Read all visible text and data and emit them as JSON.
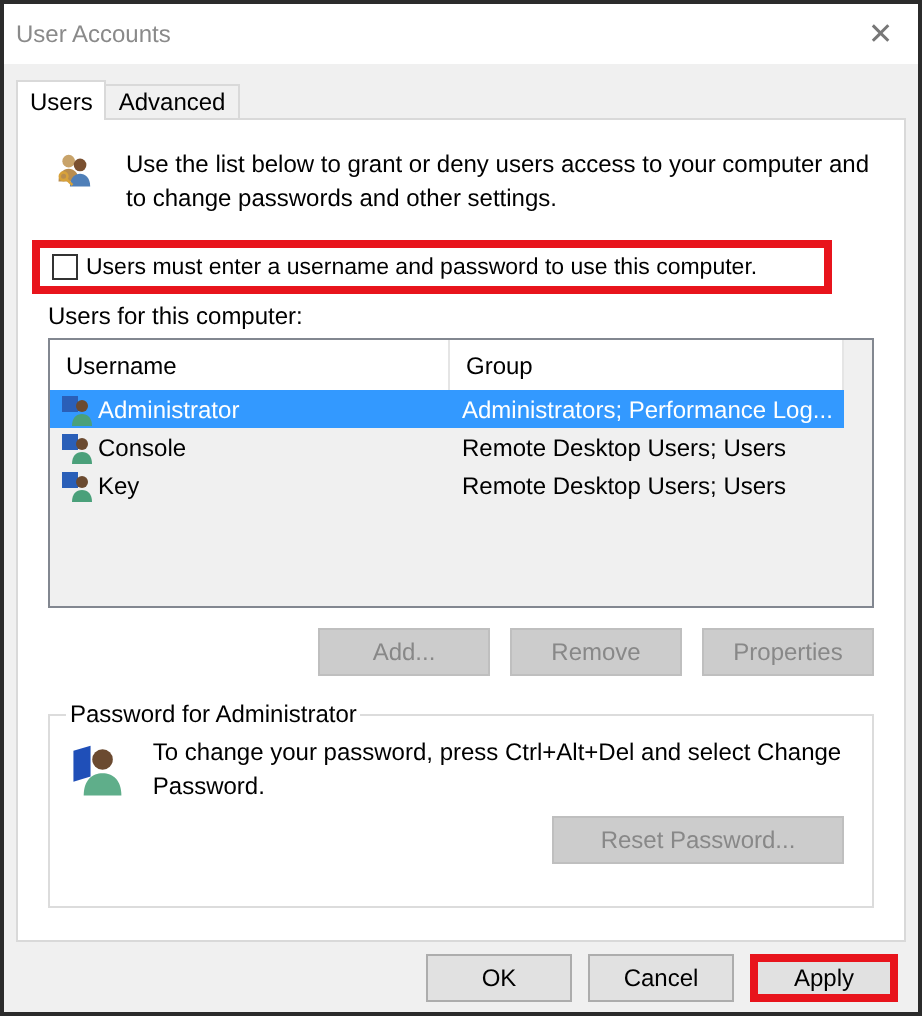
{
  "window": {
    "title": "User Accounts",
    "close": "✕"
  },
  "tabs": [
    {
      "label": "Users",
      "selected": true
    },
    {
      "label": "Advanced",
      "selected": false
    }
  ],
  "intro": "Use the list below to grant or deny users access to your computer and to change passwords and other settings.",
  "require_login": {
    "label": "Users must enter a username and password to use this computer.",
    "checked": false,
    "highlighted": true
  },
  "users_label": "Users for this computer:",
  "table": {
    "columns": [
      "Username",
      "Group"
    ],
    "rows": [
      {
        "username": "Administrator",
        "group": "Administrators; Performance Log...",
        "selected": true
      },
      {
        "username": "Console",
        "group": "Remote Desktop Users; Users",
        "selected": false
      },
      {
        "username": "Key",
        "group": "Remote Desktop Users; Users",
        "selected": false
      }
    ]
  },
  "list_buttons": [
    {
      "label": "Add...",
      "disabled": true
    },
    {
      "label": "Remove",
      "disabled": true
    },
    {
      "label": "Properties",
      "disabled": true
    }
  ],
  "password_group": {
    "title": "Password for Administrator",
    "text": "To change your password, press Ctrl+Alt+Del and select Change Password.",
    "button": {
      "label": "Reset Password...",
      "disabled": true
    }
  },
  "dialog_buttons": [
    {
      "label": "OK",
      "highlighted": false
    },
    {
      "label": "Cancel",
      "highlighted": false
    },
    {
      "label": "Apply",
      "highlighted": true
    }
  ]
}
